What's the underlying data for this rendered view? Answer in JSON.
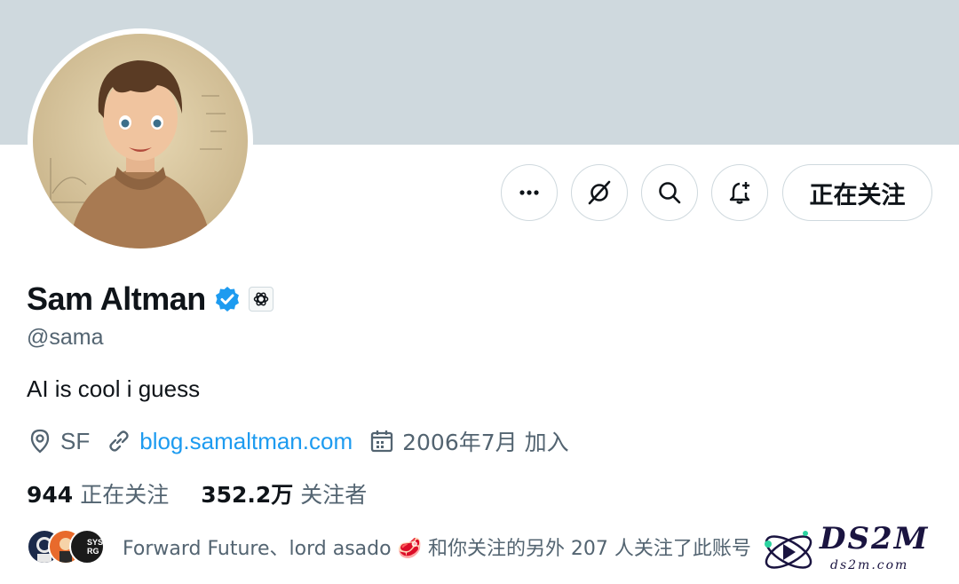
{
  "profile": {
    "name": "Sam Altman",
    "handle": "@sama",
    "bio": "AI is cool i guess",
    "location": "SF",
    "website": "blog.samaltman.com",
    "joined": "2006年7月 加入"
  },
  "actions": {
    "more_icon": "more-icon",
    "grok_icon": "grok-icon",
    "search_icon": "search-icon",
    "notify_icon": "bell-plus-icon",
    "follow_label": "正在关注"
  },
  "stats": {
    "following_count": "944",
    "following_label": "正在关注",
    "followers_count": "352.2万",
    "followers_label": "关注者"
  },
  "followed_by": {
    "text": "Forward Future、lord asado 🥩 和你关注的另外 207 人关注了此账号",
    "badge_text": "SYS RG"
  },
  "watermark": {
    "brand": "DS2M",
    "url": "ds2m.com"
  },
  "colors": {
    "accent": "#1d9bf0",
    "banner": "#cfd9de",
    "secondary_text": "#536471"
  }
}
